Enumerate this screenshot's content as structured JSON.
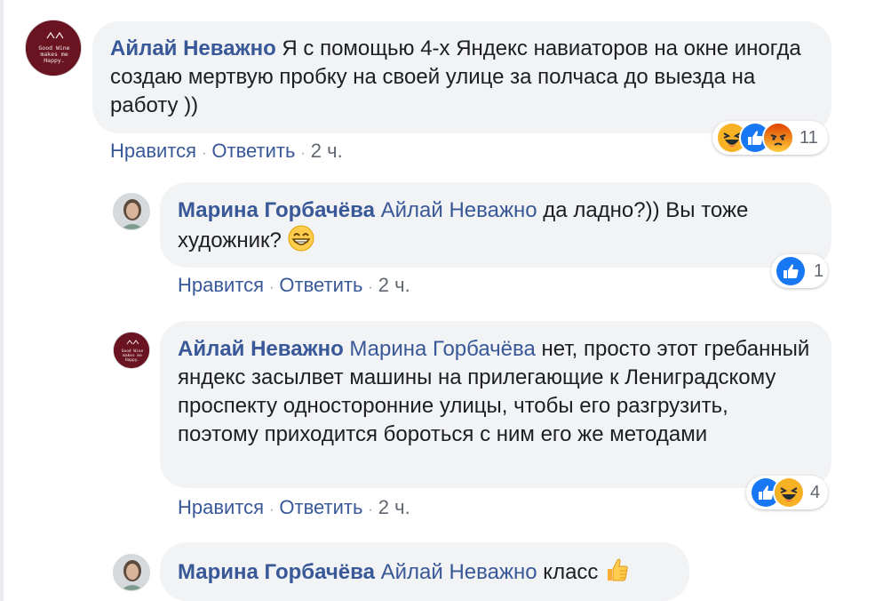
{
  "comments": [
    {
      "author": "Айлай Неважно",
      "text": "Я с помощью 4-х Яндекс навиаторов на окне иногда создаю мертвую пробку на своей улице за полчаса до выезда на работу ))",
      "like_label": "Нравится",
      "reply_label": "Ответить",
      "time": "2 ч.",
      "reaction_count": "11",
      "reactions": [
        "haha-icon",
        "like-icon",
        "angry-icon"
      ],
      "avatar_text": "Good Wine makes me Happy"
    },
    {
      "author": "Марина Горбачёва",
      "mention": "Айлай Неважно",
      "text": "да ладно?)) Вы тоже художник?",
      "like_label": "Нравится",
      "reply_label": "Ответить",
      "time": "2 ч.",
      "reaction_count": "1",
      "reactions": [
        "like-icon"
      ]
    },
    {
      "author": "Айлай Неважно",
      "mention": "Марина Горбачёва",
      "text": "нет, просто этот гребанный яндекс засылвет машины на прилегающие к Лениградскому проспекту односторонние улицы, чтобы его разгрузить, поэтому приходится бороться с ним его же методами",
      "like_label": "Нравится",
      "reply_label": "Ответить",
      "time": "2 ч.",
      "reaction_count": "4",
      "reactions": [
        "like-icon",
        "haha-icon"
      ]
    },
    {
      "author": "Марина Горбачёва",
      "mention": "Айлай Неважно",
      "text": "класс"
    }
  ],
  "colors": {
    "link": "#385898",
    "bubble": "#f2f3f5",
    "like": "#1877f2",
    "haha": "#f7b125",
    "angry": "#e9710f"
  }
}
